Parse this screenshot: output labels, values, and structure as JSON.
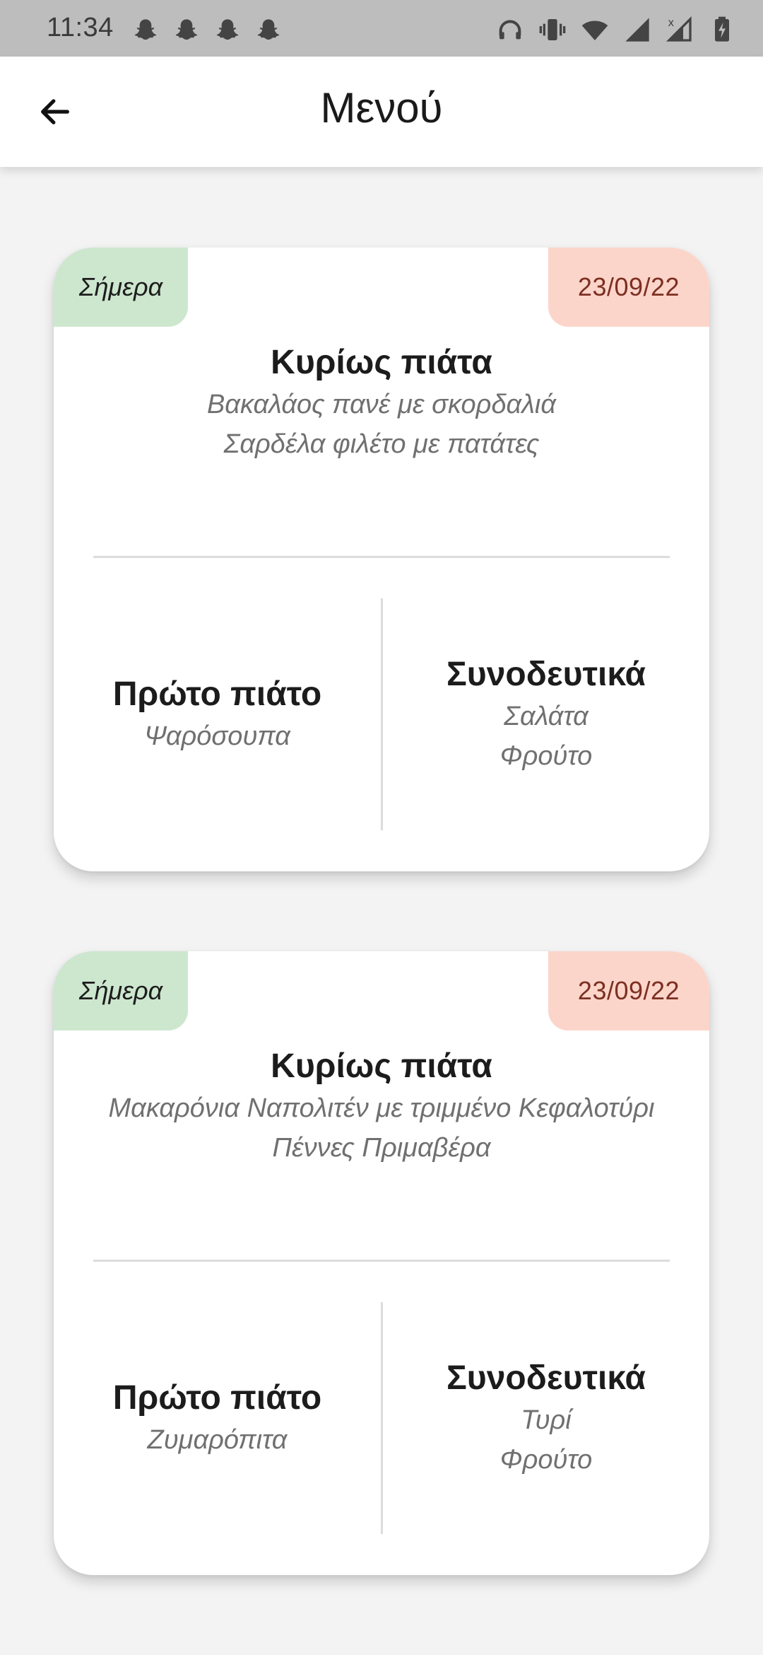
{
  "status_bar": {
    "time": "11:34",
    "left_icons": [
      "snapchat-icon",
      "snapchat-icon",
      "snapchat-icon",
      "snapchat-icon"
    ],
    "right_icons": [
      "headphones-icon",
      "vibrate-icon",
      "wifi-icon",
      "signal-icon",
      "signal-no-data-icon",
      "battery-charging-icon"
    ]
  },
  "app_bar": {
    "title": "Μενού",
    "back_icon": "arrow-left-icon"
  },
  "colors": {
    "today_badge_bg": "#cde7cf",
    "date_badge_bg": "#fcd5ca",
    "date_text": "#7c2f22"
  },
  "cards": [
    {
      "today_label": "Σήμερα",
      "date": "23/09/22",
      "main": {
        "title": "Κυρίως πιάτα",
        "items": [
          "Βακαλάος πανέ με σκορδαλιά",
          "Σαρδέλα φιλέτο με πατάτες"
        ]
      },
      "first_course": {
        "title": "Πρώτο πιάτο",
        "items": [
          "Ψαρόσουπα"
        ]
      },
      "sides": {
        "title": "Συνοδευτικά",
        "items": [
          "Σαλάτα",
          "Φρούτο"
        ]
      }
    },
    {
      "today_label": "Σήμερα",
      "date": "23/09/22",
      "main": {
        "title": "Κυρίως πιάτα",
        "items": [
          "Μακαρόνια Ναπολιτέν με τριμμένο Κεφαλοτύρι",
          "Πέννες Πριμαβέρα"
        ]
      },
      "first_course": {
        "title": "Πρώτο πιάτο",
        "items": [
          "Ζυμαρόπιτα"
        ]
      },
      "sides": {
        "title": "Συνοδευτικά",
        "items": [
          "Τυρί",
          "Φρούτο"
        ]
      }
    }
  ]
}
